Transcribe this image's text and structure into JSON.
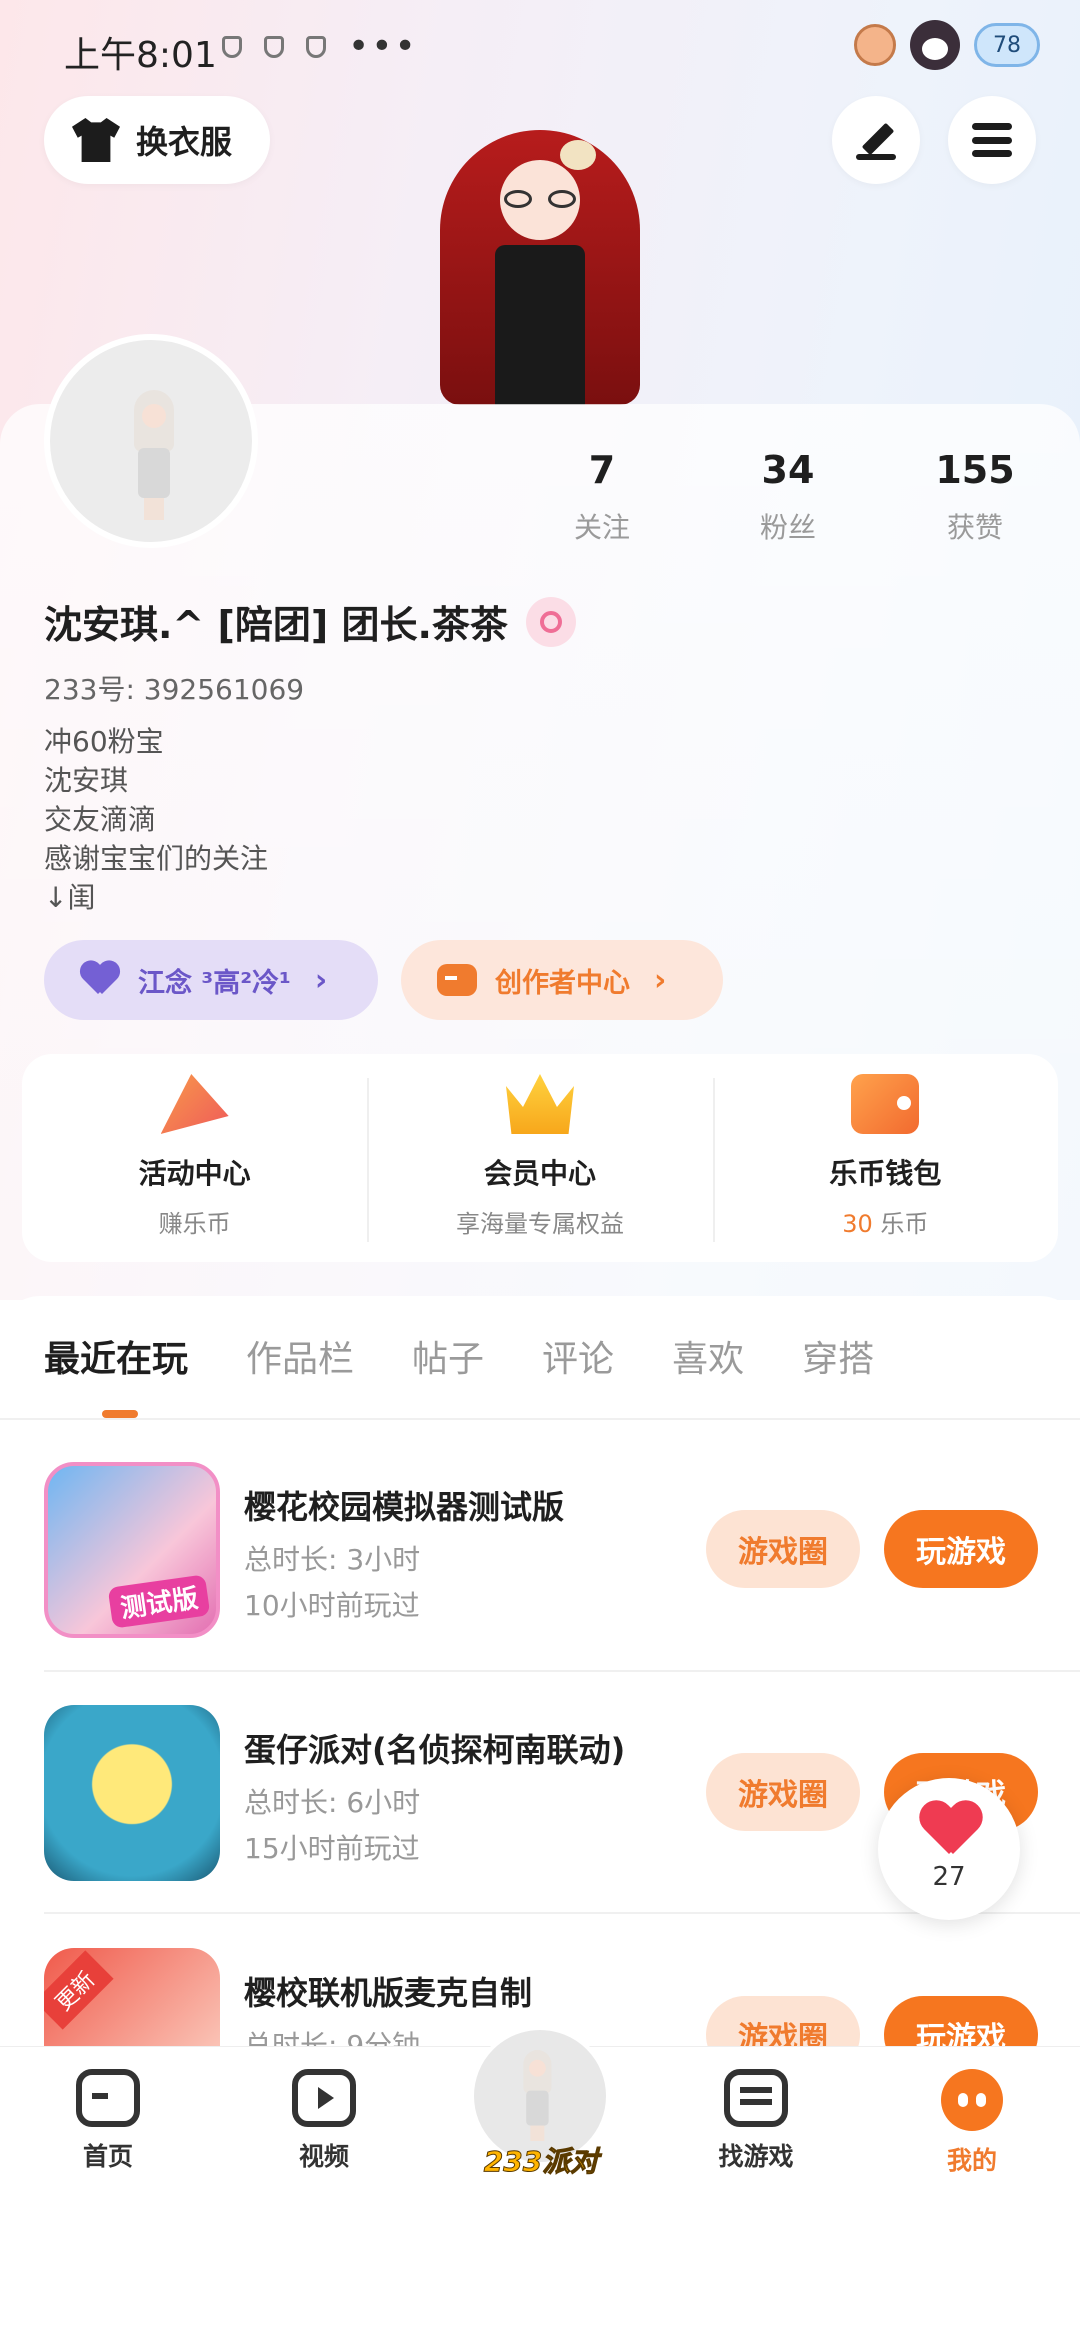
{
  "status_bar": {
    "time": "上午8:01",
    "battery": "78"
  },
  "top": {
    "outfit_label": "换衣服"
  },
  "profile": {
    "stats": [
      {
        "value": "7",
        "label": "关注"
      },
      {
        "value": "34",
        "label": "粉丝"
      },
      {
        "value": "155",
        "label": "获赞"
      }
    ],
    "name": "沈安琪.^ [陪团] 团长.茶茶",
    "id_line": "233号: 392561069",
    "bio": [
      "冲60粉宝",
      "沈安琪",
      "交友滴滴",
      "感谢宝宝们的关注",
      "↓闺"
    ],
    "family_pill": "江念 ³高²冷¹",
    "creator_pill": "创作者中心"
  },
  "quick": [
    {
      "title": "活动中心",
      "sub": "赚乐币",
      "icon": "party-popper-icon"
    },
    {
      "title": "会员中心",
      "sub": "享海量专属权益",
      "icon": "crown-icon"
    },
    {
      "title": "乐币钱包",
      "sub_value": "30",
      "sub_unit": " 乐币",
      "icon": "wallet-icon"
    }
  ],
  "tabs": [
    "最近在玩",
    "作品栏",
    "帖子",
    "评论",
    "喜欢",
    "穿搭"
  ],
  "games": [
    {
      "title": "樱花校园模拟器测试版",
      "duration": "总时长: 3小时",
      "last": "10小时前玩过",
      "badge": "测试版"
    },
    {
      "title": "蛋仔派对(名侦探柯南联动)",
      "duration": "总时长: 6小时",
      "last": "15小时前玩过"
    },
    {
      "title": "樱校联机版麦克自制",
      "duration": "总时长: 9分钟",
      "last": "",
      "badge": "更新"
    }
  ],
  "game_buttons": {
    "circle": "游戏圈",
    "play": "玩游戏"
  },
  "float_like": {
    "count": "27"
  },
  "nav": [
    {
      "label": "首页"
    },
    {
      "label": "视频"
    },
    {
      "label": "233派对"
    },
    {
      "label": "找游戏"
    },
    {
      "label": "我的"
    }
  ]
}
